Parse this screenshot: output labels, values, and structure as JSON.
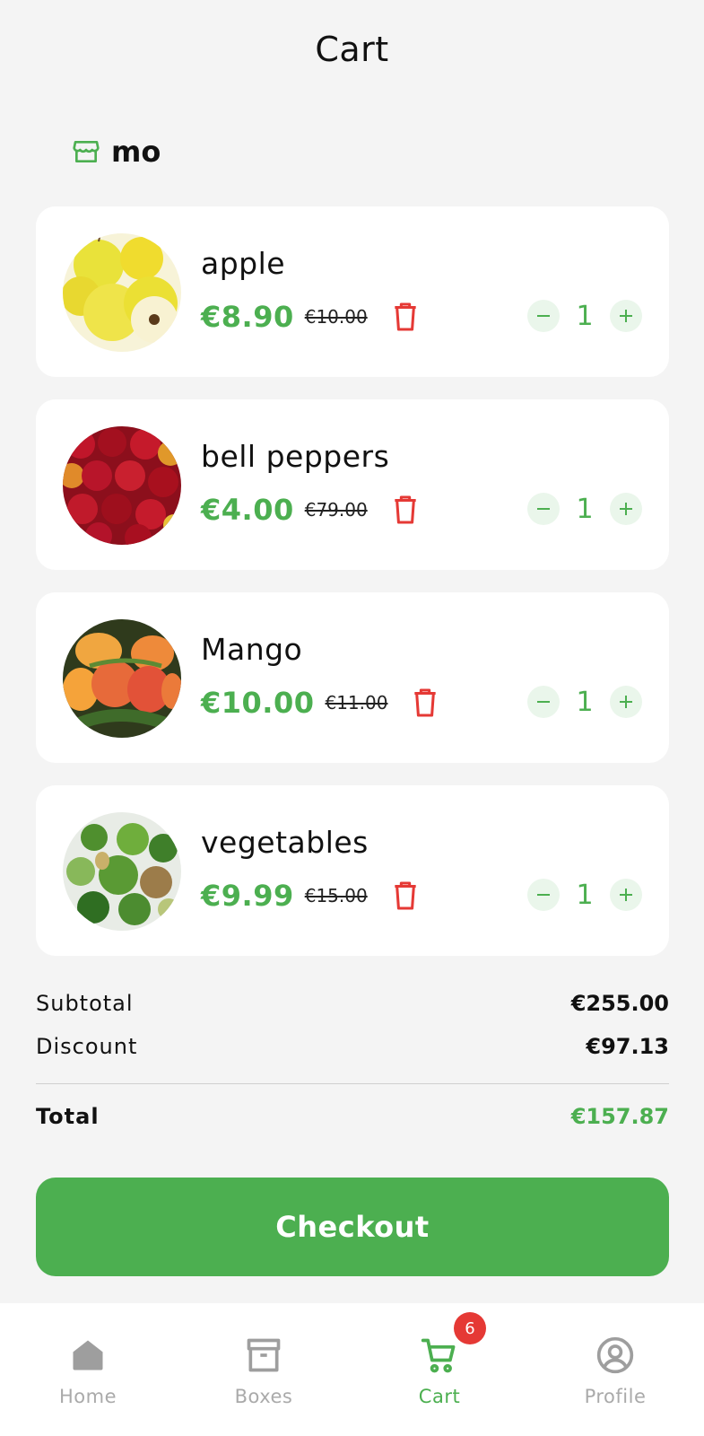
{
  "header": {
    "title": "Cart"
  },
  "store": {
    "name": "mo",
    "icon": "storefront-icon"
  },
  "items": [
    {
      "name": "apple",
      "price": "€8.90",
      "old_price": "€10.00",
      "qty": "1"
    },
    {
      "name": "bell peppers",
      "price": "€4.00",
      "old_price": "€79.00",
      "qty": "1"
    },
    {
      "name": "Mango",
      "price": "€10.00",
      "old_price": "€11.00",
      "qty": "1"
    },
    {
      "name": "vegetables",
      "price": "€9.99",
      "old_price": "€15.00",
      "qty": "1"
    }
  ],
  "summary": {
    "subtotal_label": "Subtotal",
    "subtotal": "€255.00",
    "discount_label": "Discount",
    "discount": "€97.13",
    "total_label": "Total",
    "total": "€157.87"
  },
  "checkout_label": "Checkout",
  "tabs": [
    {
      "label": "Home",
      "icon": "home-icon"
    },
    {
      "label": "Boxes",
      "icon": "archive-box-icon"
    },
    {
      "label": "Cart",
      "icon": "cart-icon",
      "badge": "6"
    },
    {
      "label": "Profile",
      "icon": "user-circle-icon"
    }
  ],
  "colors": {
    "accent": "#4caf50",
    "danger": "#e53935",
    "background": "#f4f4f4"
  }
}
